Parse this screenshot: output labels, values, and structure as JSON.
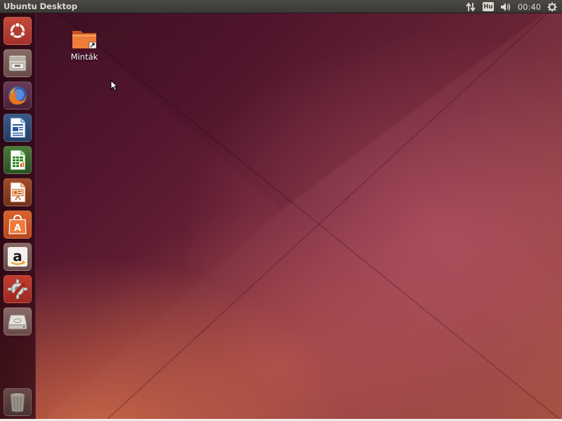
{
  "top_panel": {
    "title": "Ubuntu Desktop",
    "keyboard_layout": "Hu",
    "clock": "00:40",
    "indicators": [
      "network-icon",
      "keyboard-layout-indicator",
      "sound-icon",
      "clock",
      "gear-icon"
    ]
  },
  "launcher": {
    "items": [
      {
        "name": "dash-home",
        "icon": "ubuntu-logo-icon"
      },
      {
        "name": "files",
        "icon": "file-cabinet-icon"
      },
      {
        "name": "firefox",
        "icon": "firefox-icon"
      },
      {
        "name": "libreoffice-writer",
        "icon": "writer-document-icon"
      },
      {
        "name": "libreoffice-calc",
        "icon": "calc-spreadsheet-icon"
      },
      {
        "name": "libreoffice-impress",
        "icon": "impress-presentation-icon"
      },
      {
        "name": "ubuntu-software-center",
        "icon": "shopping-bag-icon"
      },
      {
        "name": "amazon",
        "icon": "amazon-icon"
      },
      {
        "name": "system-settings",
        "icon": "settings-gear-wrench-icon"
      },
      {
        "name": "drive",
        "icon": "hard-drive-icon"
      }
    ],
    "trash": {
      "name": "trash",
      "icon": "trash-icon"
    }
  },
  "desktop": {
    "icons": [
      {
        "label": "Minták",
        "icon": "folder-link-icon"
      }
    ]
  },
  "colors": {
    "panel": "#3a3935",
    "panel_text": "#dfdbd2",
    "launcher_active": "#c44a3a",
    "accent_orange": "#dd4814"
  }
}
